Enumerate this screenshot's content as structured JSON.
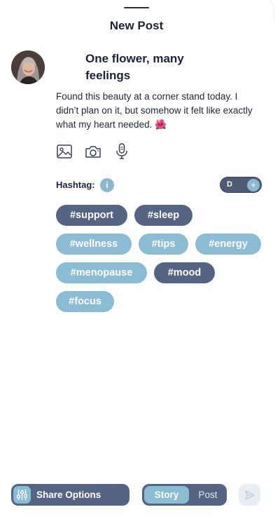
{
  "header": {
    "title": "New Post"
  },
  "post": {
    "title": "One flower, many feelings",
    "body": "Found this beauty at a corner stand today. I didn’t plan on it, but somehow it felt like exactly what my heart needed. 🌺"
  },
  "media": {
    "icons": [
      "image-icon",
      "camera-icon",
      "microphone-icon"
    ]
  },
  "hashtags": {
    "label": "Hashtag:",
    "info_icon": "i",
    "toggle_label": "D",
    "toggle_icon": "+",
    "tags": [
      {
        "text": "#support",
        "selected": true
      },
      {
        "text": "#sleep",
        "selected": true
      },
      {
        "text": "#wellness",
        "selected": false
      },
      {
        "text": "#tips",
        "selected": false
      },
      {
        "text": "#energy",
        "selected": false
      },
      {
        "text": "#menopause",
        "selected": false
      },
      {
        "text": "#mood",
        "selected": true
      },
      {
        "text": "#focus",
        "selected": false
      }
    ]
  },
  "bottom": {
    "share_label": "Share Options",
    "segment": {
      "story": "Story",
      "post": "Post",
      "active": "Story"
    }
  },
  "colors": {
    "accent_dark": "#556482",
    "accent_light": "#8bbcd4",
    "text": "#1d2433"
  }
}
